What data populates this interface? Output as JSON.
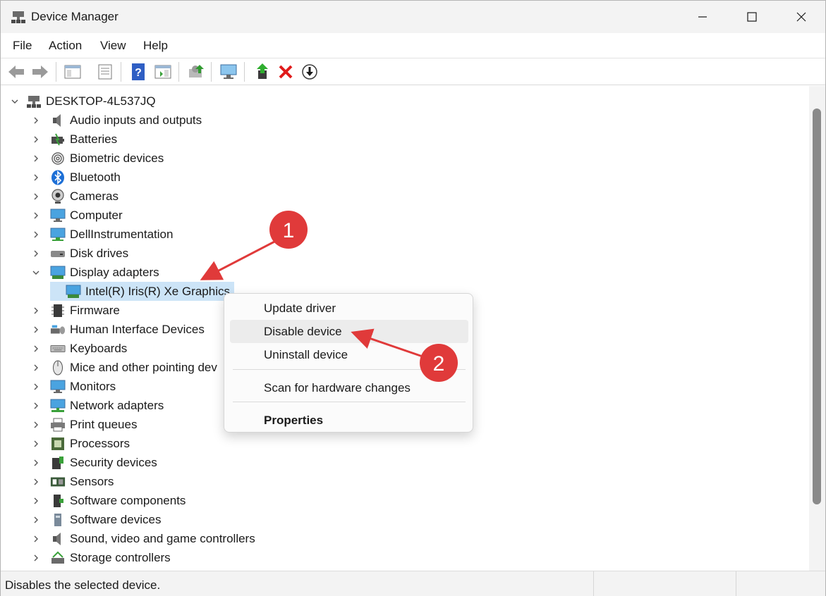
{
  "window": {
    "title": "Device Manager"
  },
  "menu": {
    "file": "File",
    "action": "Action",
    "view": "View",
    "help": "Help"
  },
  "toolbar": {
    "buttons": [
      "back-icon",
      "forward-icon",
      "show-hide-console-tree-icon",
      "properties-icon",
      "help-icon",
      "action-pane-icon",
      "scan-hardware-icon",
      "monitor-icon",
      "update-driver-icon",
      "uninstall-icon",
      "disable-icon"
    ]
  },
  "tree": {
    "root": "DESKTOP-4L537JQ",
    "categories": [
      {
        "label": "Audio inputs and outputs",
        "icon": "speaker-icon"
      },
      {
        "label": "Batteries",
        "icon": "battery-icon"
      },
      {
        "label": "Biometric devices",
        "icon": "fingerprint-icon"
      },
      {
        "label": "Bluetooth",
        "icon": "bluetooth-icon"
      },
      {
        "label": "Cameras",
        "icon": "camera-icon"
      },
      {
        "label": "Computer",
        "icon": "computer-icon"
      },
      {
        "label": "DellInstrumentation",
        "icon": "network-computer-icon"
      },
      {
        "label": "Disk drives",
        "icon": "disk-drive-icon"
      },
      {
        "label": "Display adapters",
        "icon": "display-adapter-icon",
        "expanded": true
      },
      {
        "label": "Firmware",
        "icon": "chip-icon"
      },
      {
        "label": "Human Interface Devices",
        "icon": "hid-icon"
      },
      {
        "label": "Keyboards",
        "icon": "keyboard-icon"
      },
      {
        "label": "Mice and other pointing dev",
        "icon": "mouse-icon"
      },
      {
        "label": "Monitors",
        "icon": "monitor-icon"
      },
      {
        "label": "Network adapters",
        "icon": "network-adapter-icon"
      },
      {
        "label": "Print queues",
        "icon": "printer-icon"
      },
      {
        "label": "Processors",
        "icon": "processor-icon"
      },
      {
        "label": "Security devices",
        "icon": "security-device-icon"
      },
      {
        "label": "Sensors",
        "icon": "sensor-icon"
      },
      {
        "label": "Software components",
        "icon": "software-component-icon"
      },
      {
        "label": "Software devices",
        "icon": "software-device-icon"
      },
      {
        "label": "Sound, video and game controllers",
        "icon": "speaker-icon"
      },
      {
        "label": "Storage controllers",
        "icon": "storage-controller-icon"
      }
    ],
    "child_device": "Intel(R) Iris(R) Xe Graphics"
  },
  "context_menu": {
    "update_driver": "Update driver",
    "disable_device": "Disable device",
    "uninstall_device": "Uninstall device",
    "scan": "Scan for hardware changes",
    "properties": "Properties"
  },
  "annotations": {
    "badge1": "1",
    "badge2": "2",
    "color": "#e03a3a"
  },
  "status": {
    "text": "Disables the selected device."
  }
}
